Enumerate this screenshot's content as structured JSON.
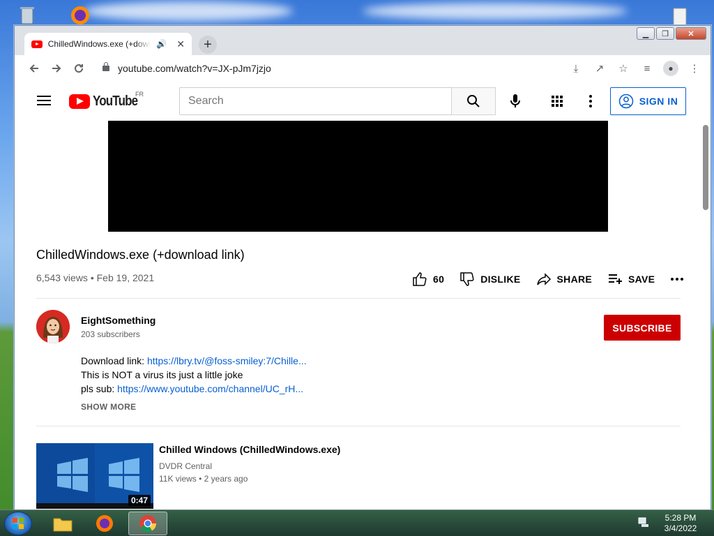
{
  "browser": {
    "tab_title": "ChilledWindows.exe (+download link)",
    "url": "youtube.com/watch?v=JX-pJm7jzjo"
  },
  "youtube": {
    "logo_text": "YouTube",
    "country_code": "FR",
    "search_placeholder": "Search",
    "sign_in_label": "SIGN IN"
  },
  "video": {
    "title": "ChilledWindows.exe (+download link)",
    "views_date": "6,543 views • Feb 19, 2021",
    "like_count": "60",
    "dislike_label": "DISLIKE",
    "share_label": "SHARE",
    "save_label": "SAVE"
  },
  "channel": {
    "name": "EightSomething",
    "subscribers": "203 subscribers",
    "subscribe_label": "SUBSCRIBE"
  },
  "description": {
    "line1_prefix": "Download link: ",
    "line1_link": "https://lbry.tv/@foss-smiley:7/Chille...",
    "line2": "This is NOT a virus its just a little joke",
    "line3_prefix": "pls sub: ",
    "line3_link": "https://www.youtube.com/channel/UC_rH...",
    "show_more": "SHOW MORE"
  },
  "recommended": [
    {
      "title": "Chilled Windows (ChilledWindows.exe)",
      "channel": "DVDR Central",
      "meta": "11K views • 2 years ago",
      "duration": "0:47"
    }
  ],
  "taskbar": {
    "time": "5:28 PM",
    "date": "3/4/2022"
  },
  "colors": {
    "youtube_red": "#ff0000",
    "subscribe_red": "#cc0000",
    "link_blue": "#065fd4"
  }
}
